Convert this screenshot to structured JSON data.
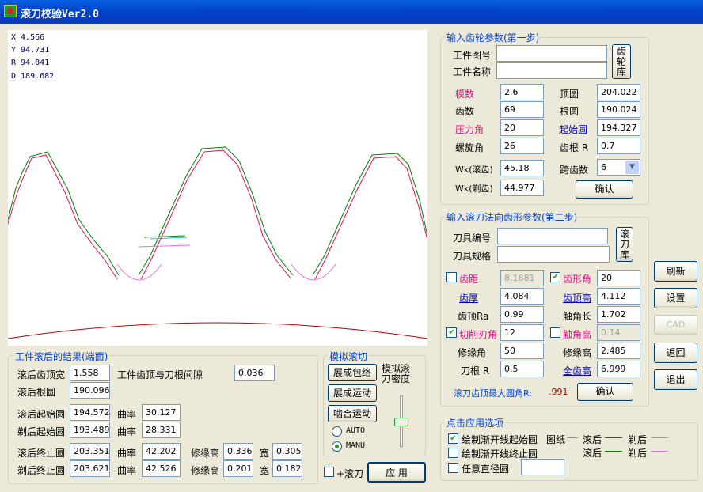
{
  "app": {
    "title": "滚刀校验Ver2.0"
  },
  "readout": {
    "x": "X 4.566",
    "y": "Y 94.731",
    "r": "R 94.841",
    "d": "D 189.682"
  },
  "colors": {
    "rolled": "#008000",
    "shaved": "#e0106a",
    "rolled_root": "#20c0c0",
    "shaved_root": "#e070e0",
    "plot_bg": "#ffffff",
    "accent": "#0046d5"
  },
  "step1": {
    "title": "输入齿轮参数(第一步)",
    "part_no_label": "工件图号",
    "part_no": "",
    "part_name_label": "工件名称",
    "part_name": "",
    "gear_lib_button": "齿轮库",
    "module_label": "模数",
    "module": "2.6",
    "tip_label": "顶圆",
    "tip": "204.022",
    "teeth_label": "齿数",
    "teeth": "69",
    "root_label": "根圆",
    "root": "190.024",
    "pressure_label": "压力角",
    "pressure": "20",
    "start_label": "起始圆",
    "start": "194.327",
    "helix_label": "螺旋角",
    "helix": "26",
    "root_r_label": "齿根 R",
    "root_r": "0.7",
    "wk_roll_label": "Wk(滚齿)",
    "wk_roll": "45.18",
    "span_label": "跨齿数",
    "span": "6",
    "wk_shave_label": "Wk(剃齿)",
    "wk_shave": "44.977",
    "confirm": "确认"
  },
  "step2": {
    "title": "输入滚刀法向齿形参数(第二步)",
    "tool_no_label": "刀具编号",
    "tool_no": "",
    "tool_spec_label": "刀具规格",
    "tool_spec": "",
    "hob_lib_button": "滚刀库",
    "pitch_label": "齿距",
    "pitch": "8.1681",
    "profile_angle_label": "齿形角",
    "profile_angle": "20",
    "thickness_label": "齿厚",
    "thickness": "4.084",
    "addendum_label": "齿顶高",
    "addendum": "4.112",
    "tip_ra_label": "齿顶Ra",
    "tip_ra": "0.99",
    "contact_len_label": "触角长",
    "contact_len": "1.702",
    "cut_angle_label": "切削刃角",
    "cut_angle": "12",
    "contact_h_label": "触角高",
    "contact_h": "0.14",
    "mod_angle_label": "修缘角",
    "mod_angle": "50",
    "mod_h_label": "修缘高",
    "mod_h": "2.485",
    "root_r_label": "刀根 R",
    "root_r": "0.5",
    "full_h_label": "全齿高",
    "full_h": "6.999",
    "max_radius_label": "滚刀齿顶最大圆角R:",
    "max_radius": ".991",
    "confirm": "确认"
  },
  "results": {
    "title": "工件滚后的结果(端面)",
    "tip_width_label": "滚后齿顶宽",
    "tip_width": "1.558",
    "clearance_label": "工件齿顶与刀根间隙",
    "clearance": "0.036",
    "root_circle_label": "滚后根圆",
    "root_circle": "190.096",
    "roll_start_label": "滚后起始圆",
    "roll_start": "194.572",
    "curv_label": "曲率",
    "roll_start_curv": "30.127",
    "shave_start_label": "剃后起始圆",
    "shave_start": "193.489",
    "shave_start_curv": "28.331",
    "roll_end_label": "滚后终止圆",
    "roll_end": "203.351",
    "roll_end_curv": "42.202",
    "mod_h_label": "修缘高",
    "roll_end_mod": "0.336",
    "width_label": "宽",
    "roll_end_w": "0.305",
    "shave_end_label": "剃后终止圆",
    "shave_end": "203.621",
    "shave_end_curv": "42.526",
    "shave_end_mod": "0.201",
    "shave_end_w": "0.182"
  },
  "sim": {
    "title": "模拟滚切",
    "envelope": "展成包络",
    "motion": "展成运动",
    "mesh": "啮合运动",
    "density_label": "模拟滚刀密度",
    "auto": "AUTO",
    "manu": "MANU",
    "hob_check": "+滚刀",
    "apply": "应 用"
  },
  "side": {
    "refresh": "刷新",
    "settings": "设置",
    "cad": "CAD",
    "back": "返回",
    "exit": "退出"
  },
  "apply_opts": {
    "title": "点击应用选项",
    "opt1": "绘制渐开线起始圆",
    "opt2": "绘制渐开线终止圆",
    "opt3": "任意直径圆",
    "legend_label": "图纸",
    "rolled": "滚后",
    "shaved": "剃后",
    "diameter": ""
  }
}
